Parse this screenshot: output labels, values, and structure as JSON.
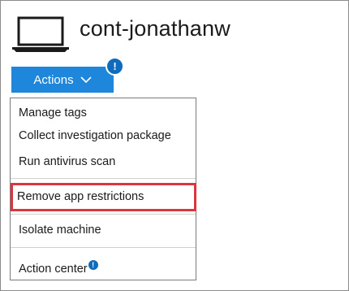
{
  "machine": {
    "name": "cont-jonathanw",
    "icon": "laptop-icon"
  },
  "actions_button": {
    "label": "Actions",
    "icon": "chevron-down-icon",
    "badge": "!"
  },
  "menu": {
    "items": [
      {
        "label": "Manage tags"
      },
      {
        "label": "Collect investigation package"
      },
      {
        "label": "Run antivirus scan"
      },
      {
        "label": "Remove app restrictions"
      },
      {
        "label": "Isolate machine"
      },
      {
        "label": "Action center",
        "badge": "!"
      }
    ]
  },
  "colors": {
    "accent": "#1e87db",
    "badge": "#0f6cbd",
    "highlight_border": "#d9363e"
  }
}
